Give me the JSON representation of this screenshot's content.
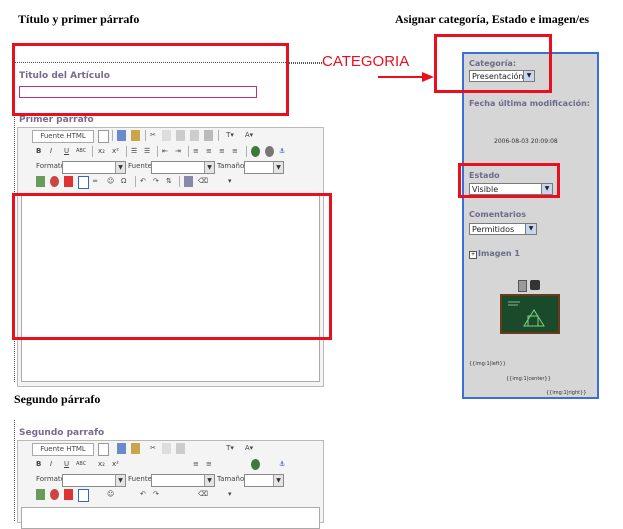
{
  "headings": {
    "left_title": "Título y primer párrafo",
    "right_title": "Asignar categoría, Estado e imagen/es",
    "second_paragraph": "Segundo párrafo"
  },
  "annotation": {
    "category_callout": "CATEGORIA",
    "accent_color": "#e8101f"
  },
  "form": {
    "title_label": "Titulo del Artículo",
    "title_value": "",
    "first_paragraph_label": "Primer parrafo",
    "second_paragraph_label": "Segundo parrafo"
  },
  "toolbar": {
    "source_button": "Fuente HTML",
    "format_label": "Formato",
    "font_label": "Fuente",
    "size_label": "Tamaño",
    "format_value": "",
    "font_value": "",
    "size_value": "",
    "row2_buttons": [
      "B",
      "I",
      "U",
      "ABC",
      "x₂",
      "x²"
    ]
  },
  "sidebar": {
    "border_color": "#3a6fd8",
    "category_label": "Categoría:",
    "category_value": "Presentación",
    "modified_label": "Fecha última modificación:",
    "modified_value": "2006-08-03 20:09:08",
    "state_label": "Estado",
    "state_value": "Visible",
    "comments_label": "Comentarios",
    "comments_value": "Permitidos",
    "image_label": "Imagen 1",
    "img_left": "{{img:1|left}}",
    "img_center": "{{img:1|center}}",
    "img_right": "{{img:1|right}}"
  }
}
